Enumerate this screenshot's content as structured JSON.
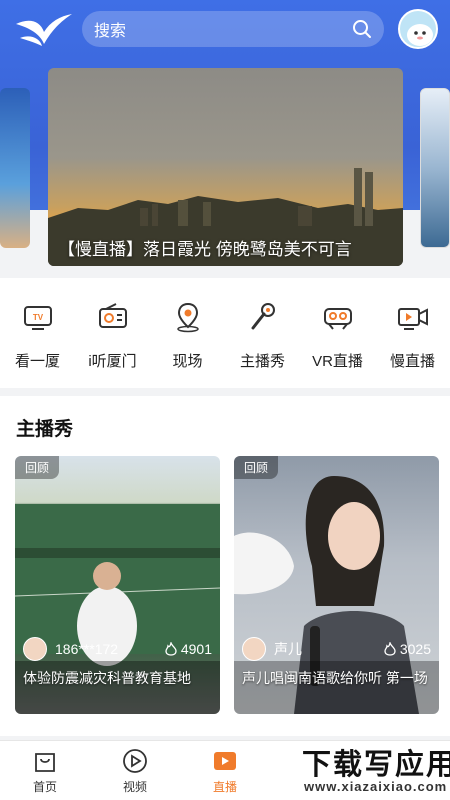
{
  "header": {
    "search_placeholder": "搜索"
  },
  "banner": {
    "title": "【慢直播】落日霞光 傍晚鹭岛美不可言"
  },
  "nav": [
    {
      "label": "看一厦",
      "icon": "tv-icon"
    },
    {
      "label": "i听厦门",
      "icon": "radio-icon"
    },
    {
      "label": "现场",
      "icon": "location-pin-icon"
    },
    {
      "label": "主播秀",
      "icon": "microphone-icon"
    },
    {
      "label": "VR直播",
      "icon": "vr-headset-icon"
    },
    {
      "label": "慢直播",
      "icon": "video-camera-icon"
    }
  ],
  "section": {
    "title": "主播秀",
    "cards": [
      {
        "tag": "回顾",
        "name": "186***172",
        "views": "4901",
        "title": "体验防震减灾科普教育基地"
      },
      {
        "tag": "回顾",
        "name": "声儿",
        "views": "3025",
        "title": "声儿唱闽南语歌给你听 第一场"
      }
    ]
  },
  "tabbar": [
    {
      "label": "首页",
      "icon": "home-bag-icon",
      "active": false
    },
    {
      "label": "视频",
      "icon": "play-circle-icon",
      "active": false
    },
    {
      "label": "直播",
      "icon": "live-tv-icon",
      "active": true
    }
  ],
  "watermark": {
    "main": "下载写应用",
    "sub": "www.xiazaixiao.com"
  },
  "colors": {
    "brand_blue": "#3f6fe6",
    "accent_orange": "#f07b2b"
  }
}
